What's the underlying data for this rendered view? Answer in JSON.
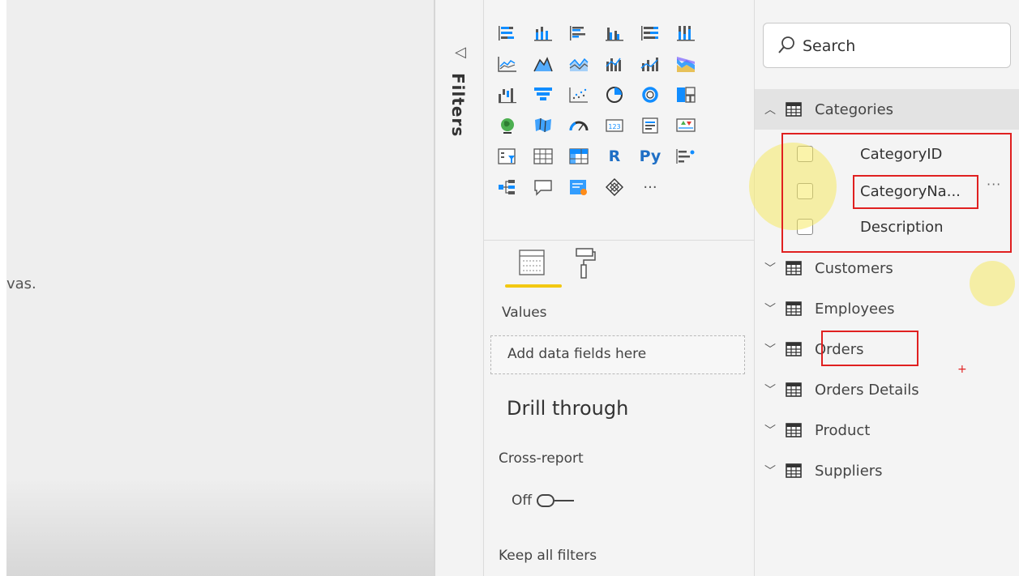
{
  "canvas": {
    "partial_text": "vas."
  },
  "filters_pane": {
    "label": "Filters"
  },
  "visualizations": {
    "icons": [
      "stacked-bar-chart-icon",
      "stacked-column-chart-icon",
      "clustered-bar-chart-icon",
      "clustered-column-chart-icon",
      "100-stacked-bar-chart-icon",
      "100-stacked-column-chart-icon",
      "line-chart-icon",
      "area-chart-icon",
      "stacked-area-chart-icon",
      "line-and-stacked-column-chart-icon",
      "line-and-clustered-column-chart-icon",
      "ribbon-chart-icon",
      "waterfall-chart-icon",
      "funnel-icon",
      "scatter-chart-icon",
      "pie-chart-icon",
      "donut-chart-icon",
      "treemap-icon",
      "map-icon",
      "filled-map-icon",
      "gauge-icon",
      "card-icon",
      "multi-row-card-icon",
      "kpi-icon",
      "slicer-icon",
      "table-icon",
      "matrix-icon",
      "r-visual-icon",
      "python-visual-icon",
      "key-influencers-icon",
      "decomposition-tree-icon",
      "qa-icon",
      "smart-narrative-icon",
      "power-apps-icon",
      "more-visuals-icon"
    ],
    "text_icons": {
      "r": "R",
      "py": "Py",
      "more": "···"
    },
    "tabs": {
      "active": "fields-tab"
    },
    "values_label": "Values",
    "values_placeholder": "Add data fields here",
    "drill_through_title": "Drill through",
    "cross_report_label": "Cross-report",
    "cross_report_toggle": "Off",
    "keep_all_filters_label": "Keep all filters"
  },
  "fields_pane": {
    "search_placeholder": "Search",
    "tables": [
      {
        "name": "Categories",
        "expanded": true,
        "fields": [
          "CategoryID",
          "CategoryNa...",
          "Description"
        ]
      },
      {
        "name": "Customers",
        "expanded": false
      },
      {
        "name": "Employees",
        "expanded": false
      },
      {
        "name": "Orders",
        "expanded": false
      },
      {
        "name": "Orders Details",
        "expanded": false
      },
      {
        "name": "Product",
        "expanded": false
      },
      {
        "name": "Suppliers",
        "expanded": false
      }
    ],
    "more_options": "···"
  },
  "annotations": {
    "plus_mark": "+"
  },
  "colors": {
    "accent_underline": "#f2c811",
    "annotation_red": "#e02020",
    "cursor_highlight": "#f5e964"
  }
}
